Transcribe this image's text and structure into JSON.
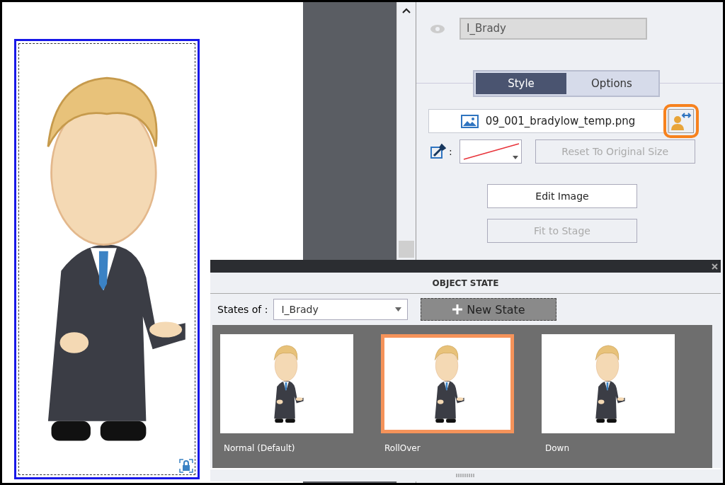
{
  "properties": {
    "name_field": {
      "value": "I_Brady"
    },
    "tabs": [
      {
        "label": "Style",
        "selected": true
      },
      {
        "label": "Options",
        "selected": false
      }
    ],
    "image_file": {
      "name": "09_001_bradylow_temp.png"
    },
    "swap_image": {
      "highlighted": true
    },
    "stroke_color_label": ":",
    "buttons": [
      {
        "label": "Reset To Original Size",
        "disabled": true
      },
      {
        "label": "Edit Image",
        "disabled": false
      },
      {
        "label": "Fit to Stage",
        "disabled": true
      }
    ]
  },
  "object_state": {
    "title": "OBJECT STATE",
    "states_of_label": "States of :",
    "object_select": "I_Brady",
    "new_state_button": "New State",
    "states": [
      {
        "label": "Normal (Default)",
        "selected": false
      },
      {
        "label": "RollOver",
        "selected": true
      },
      {
        "label": "Down",
        "selected": false
      }
    ]
  }
}
